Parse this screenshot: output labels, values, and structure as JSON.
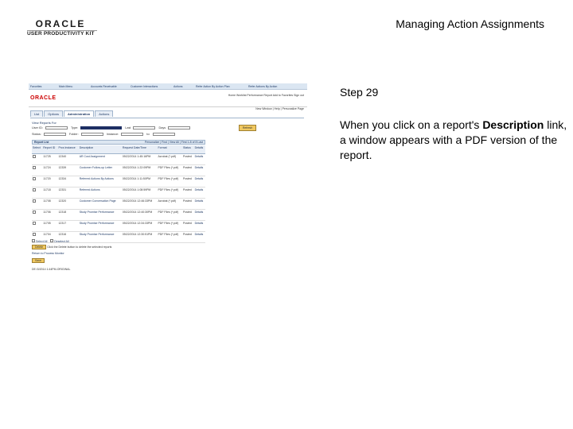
{
  "header": {
    "logo_brand": "ORACLE",
    "logo_product": "USER PRODUCTIVITY KIT",
    "doc_title": "Managing Action Assignments"
  },
  "step": {
    "title": "Step 29",
    "body_prefix": "When you click on a report's ",
    "body_bold": "Description",
    "body_suffix": " link, a window appears with a PDF version of the report."
  },
  "screenshot": {
    "topbar_links": [
      "Favorites",
      "Main Menu",
      "Accounts Receivable",
      "Customer Interactions",
      "Actions",
      "Refer Action By Action Plan",
      "Refer Actions By Action"
    ],
    "brand": "ORACLE",
    "nav_links": "Home  Worklist  Performance Report  Add to Favorites  Sign out",
    "page_header": "New Window | Help | Personalize Page",
    "tabs": [
      {
        "label": "List",
        "active": false
      },
      {
        "label": "Options",
        "active": false
      },
      {
        "label": "Administration",
        "active": true
      },
      {
        "label": "Actions",
        "active": false
      }
    ],
    "view_reports_label": "View Reports For",
    "filter_row1": {
      "user_id": "User ID:",
      "type": "Type:",
      "last": "Last",
      "days": "Days"
    },
    "filter_row2": {
      "status": "Status:",
      "folder": "Folder:",
      "instance": "Instance:",
      "to": "to:"
    },
    "refresh_label": "Refresh",
    "report_list": {
      "title": "Report List",
      "nav": "Personalize | Find | View All | First 1-8 of 8 Last"
    },
    "columns": [
      "Select",
      "Report ID",
      "Prcs Instance",
      "Description",
      "Request Date/Time",
      "Format",
      "Status",
      "Details"
    ],
    "rows": [
      {
        "id": "11725",
        "instance": "12340",
        "desc": "AR Cust Assignment",
        "date": "05/22/2014 1:45:16PM",
        "format": "Acrobat (*.pdf)",
        "status": "Posted",
        "details": "Details"
      },
      {
        "id": "11724",
        "instance": "12339",
        "desc": "Customer Follow-up Letter",
        "date": "05/22/2014 1:22:09PM",
        "format": "PDF Files (*.pdf)",
        "status": "Posted",
        "details": "Details"
      },
      {
        "id": "11720",
        "instance": "12334",
        "desc": "Referred Actions By Actions",
        "date": "05/22/2014 1:11:50PM",
        "format": "PDF Files (*.pdf)",
        "status": "Posted",
        "details": "Details"
      },
      {
        "id": "11718",
        "instance": "12331",
        "desc": "Referred Actions",
        "date": "05/22/2014 1:08:59PM",
        "format": "PDF Files (*.pdf)",
        "status": "Posted",
        "details": "Details"
      },
      {
        "id": "11708",
        "instance": "12320",
        "desc": "Customer Conversation Page",
        "date": "05/22/2014 12:46:33PM",
        "format": "Acrobat (*.pdf)",
        "status": "Posted",
        "details": "Details"
      },
      {
        "id": "11706",
        "instance": "12318",
        "desc": "Study Promise Performance",
        "date": "05/22/2014 12:40:30PM",
        "format": "PDF Files (*.pdf)",
        "status": "Posted",
        "details": "Details"
      },
      {
        "id": "11705",
        "instance": "12317",
        "desc": "Study Promise Performance",
        "date": "05/22/2014 12:34:33PM",
        "format": "PDF Files (*.pdf)",
        "status": "Posted",
        "details": "Details"
      },
      {
        "id": "11704",
        "instance": "12316",
        "desc": "Study Promise Performance",
        "date": "05/22/2014 12:30:51PM",
        "format": "PDF Files (*.pdf)",
        "status": "Posted",
        "details": "Details"
      }
    ],
    "select_all": "Select All",
    "deselect_all": "Deselect All",
    "delete_btn": "Delete",
    "delete_hint": "Click the Delete button to delete the selected reports",
    "return_link": "Return to Process Monitor",
    "save_btn": "Save",
    "footer_id": "DE:/3/2014 1:44PM-ORIGINAL"
  }
}
